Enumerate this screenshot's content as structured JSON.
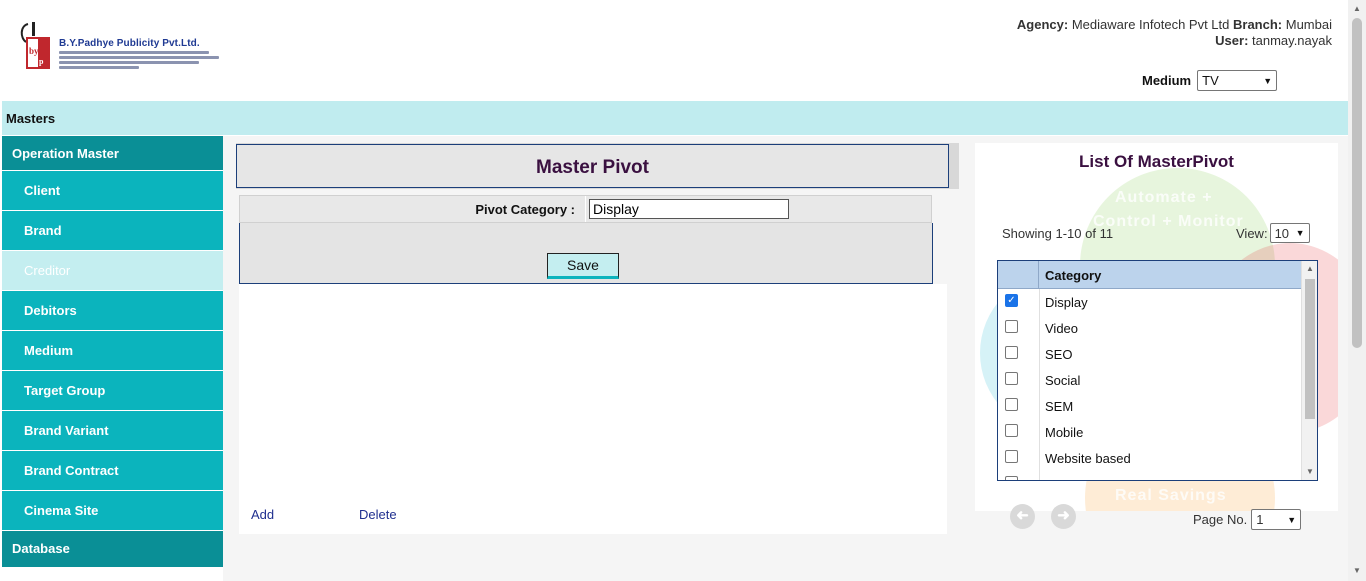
{
  "header": {
    "company_name": "B.Y.Padhye Publicity Pvt.Ltd.",
    "agency_label": "Agency:",
    "agency_value": "Mediaware Infotech Pvt Ltd",
    "branch_label": "Branch:",
    "branch_value": "Mumbai",
    "user_label": "User:",
    "user_value": "tanmay.nayak",
    "medium_label": "Medium",
    "medium_value": "TV"
  },
  "masters_bar": {
    "label": "Masters"
  },
  "sidebar": {
    "sections": [
      {
        "label": "Operation Master"
      },
      {
        "label": "Database"
      }
    ],
    "items": [
      {
        "label": "Client"
      },
      {
        "label": "Brand"
      },
      {
        "label": "Creditor"
      },
      {
        "label": "Debitors"
      },
      {
        "label": "Medium"
      },
      {
        "label": "Target Group"
      },
      {
        "label": "Brand Variant"
      },
      {
        "label": "Brand Contract"
      },
      {
        "label": "Cinema Site"
      }
    ],
    "active_item": "Creditor"
  },
  "form": {
    "title": "Master Pivot",
    "pivot_category_label": "Pivot Category :",
    "pivot_category_value": "Display",
    "save_label": "Save",
    "add_label": "Add",
    "delete_label": "Delete"
  },
  "list": {
    "title": "List Of MasterPivot",
    "showing": "Showing 1-10 of 11",
    "view_label": "View:",
    "view_value": "10",
    "column_header": "Category",
    "rows": [
      {
        "label": "Display",
        "checked": true
      },
      {
        "label": "Video",
        "checked": false
      },
      {
        "label": "SEO",
        "checked": false
      },
      {
        "label": "Social",
        "checked": false
      },
      {
        "label": "SEM",
        "checked": false
      },
      {
        "label": "Mobile",
        "checked": false
      },
      {
        "label": "Website based",
        "checked": false
      }
    ],
    "page_no_label": "Page No.",
    "page_no_value": "1",
    "watermark": {
      "line1": "Automate +",
      "line2": "Control + Monitor",
      "line3": "Real Savings"
    }
  },
  "colors": {
    "teal_dark": "#0a8f96",
    "teal": "#0bb4bd",
    "teal_light": "#c0ecef",
    "title_purple": "#3a1040",
    "border_navy": "#1c3f7a"
  }
}
